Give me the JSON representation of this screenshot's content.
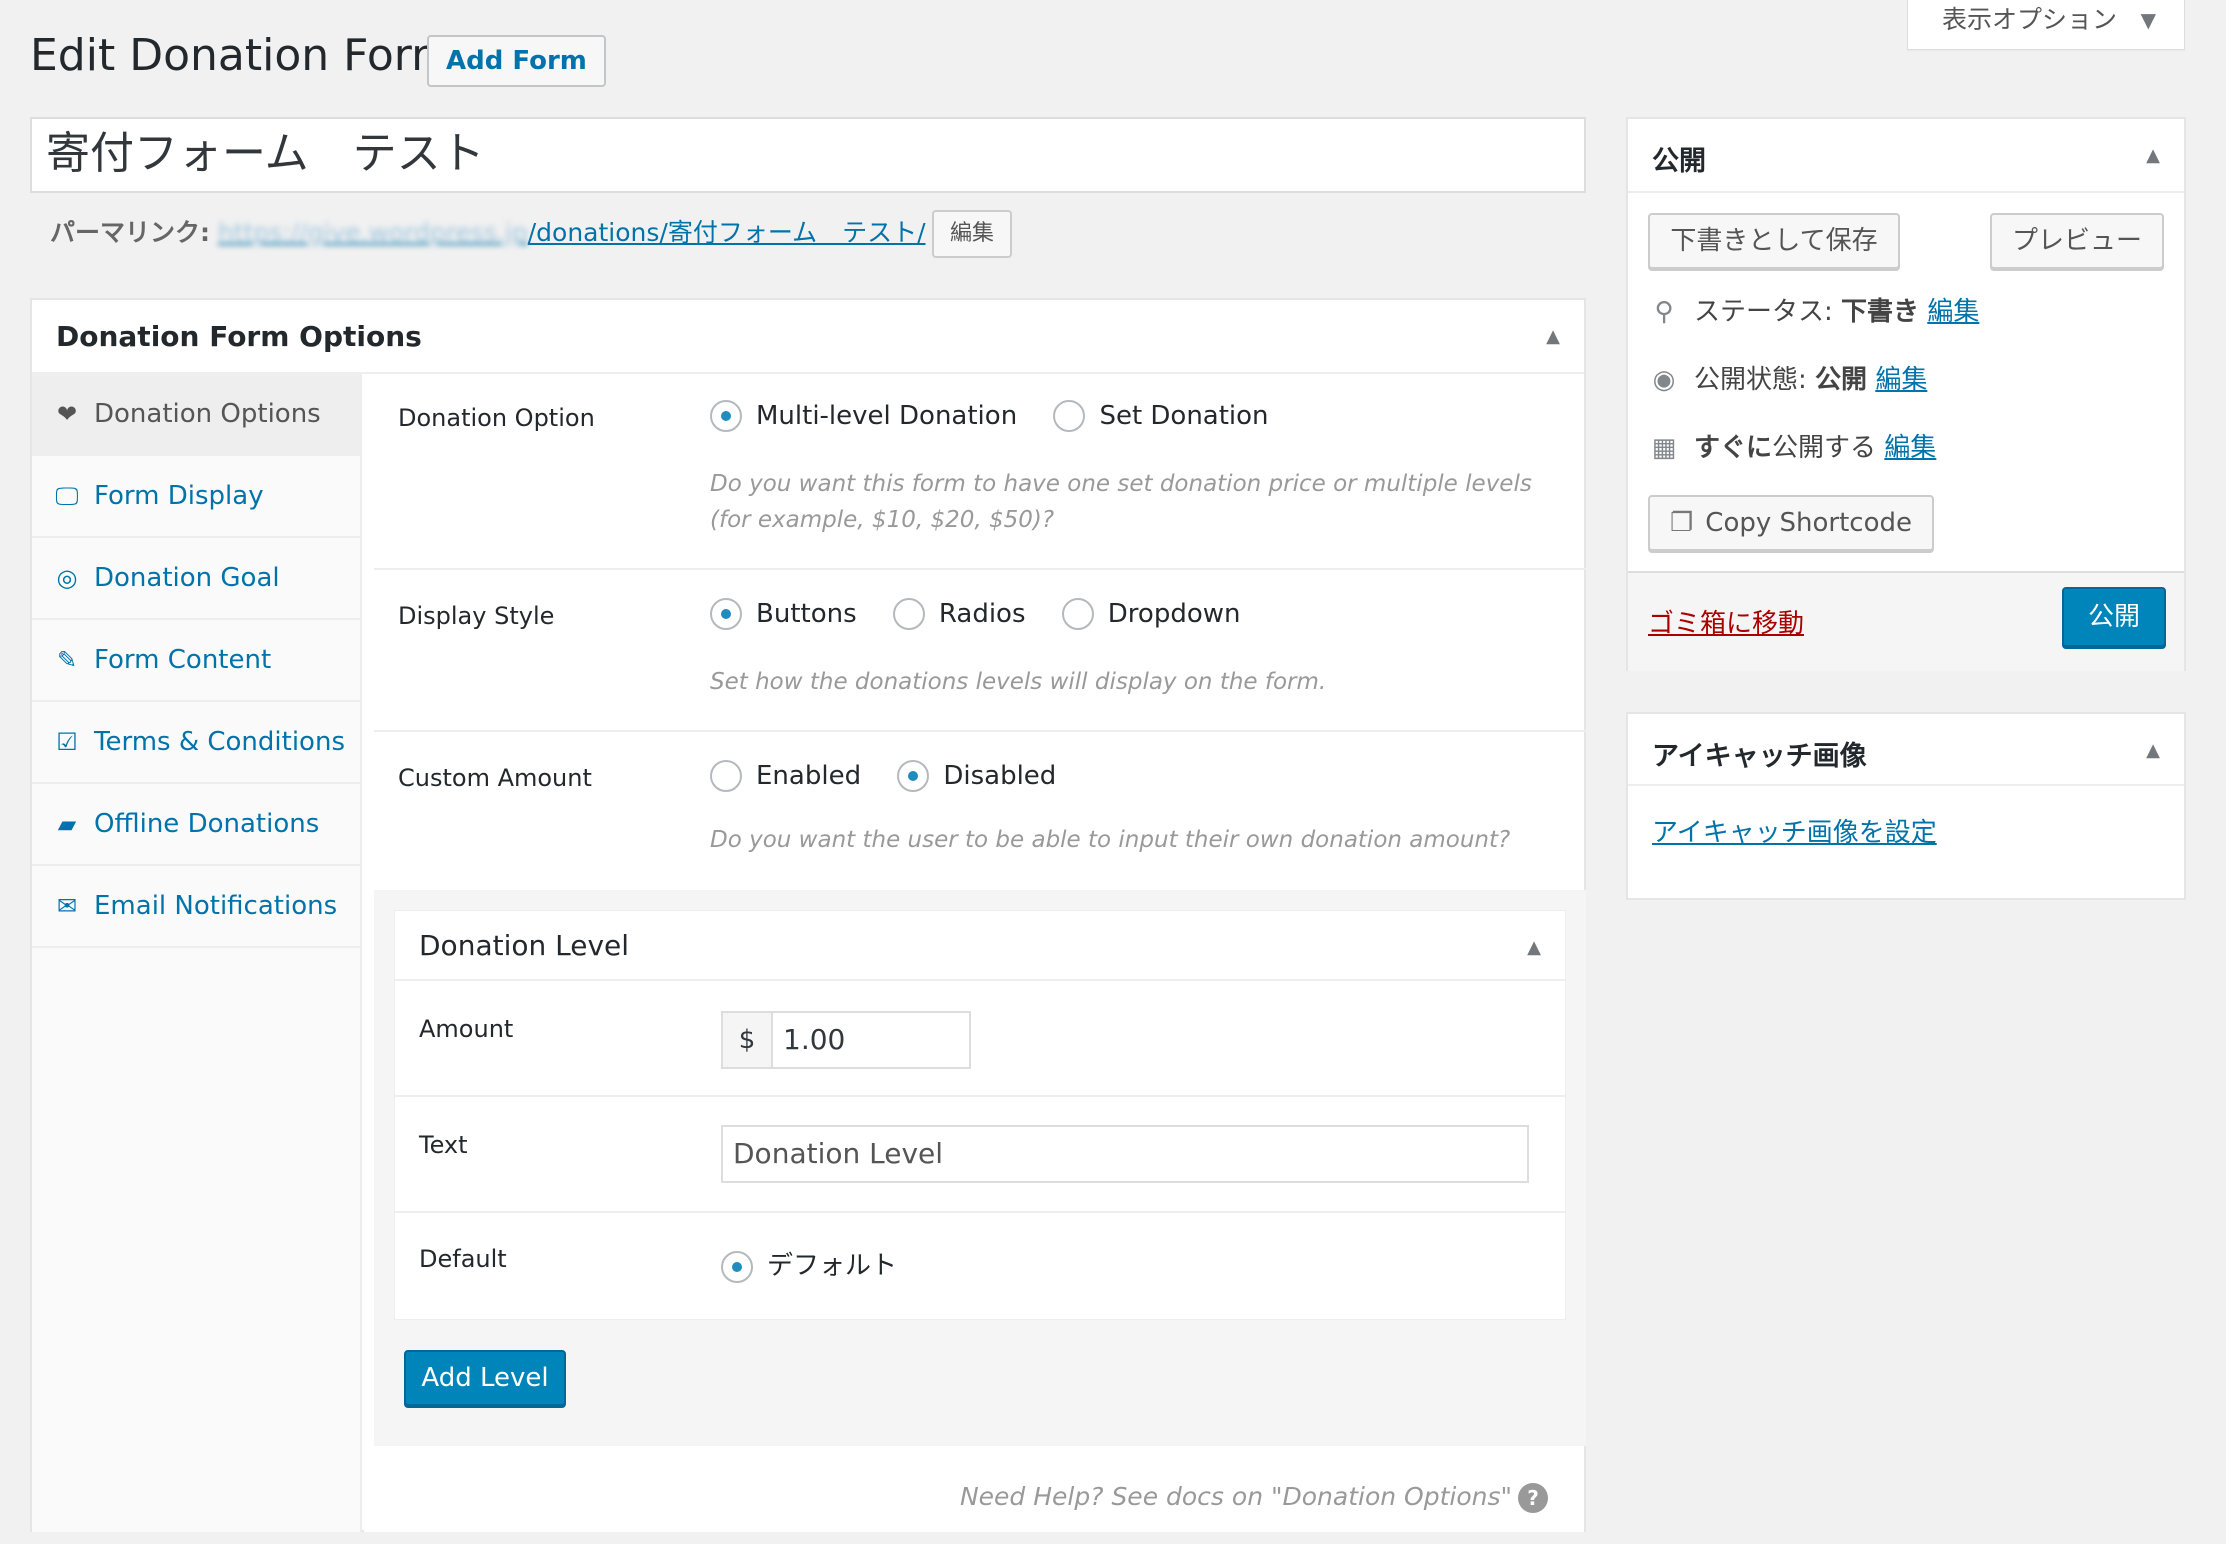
{
  "header": {
    "title": "Edit Donation Form",
    "add_form_label": "Add Form",
    "screen_options_label": "表示オプション"
  },
  "post": {
    "title_value": "寄付フォーム　テスト",
    "permalink_label": "パーマリンク:",
    "permalink_base": "https://give.wordpress.jp",
    "permalink_path": "/donations/寄付フォーム　テスト/",
    "permalink_edit_label": "編集"
  },
  "options_box": {
    "title": "Donation Form Options",
    "tabs": [
      {
        "label": "Donation Options",
        "icon": "heart-icon",
        "glyph": "❤"
      },
      {
        "label": "Form Display",
        "icon": "monitor-icon",
        "glyph": "🖵"
      },
      {
        "label": "Donation Goal",
        "icon": "target-icon",
        "glyph": "◎"
      },
      {
        "label": "Form Content",
        "icon": "edit-icon",
        "glyph": "✎"
      },
      {
        "label": "Terms & Conditions",
        "icon": "checkbox-icon",
        "glyph": "☑"
      },
      {
        "label": "Offline Donations",
        "icon": "wallet-icon",
        "glyph": "▰"
      },
      {
        "label": "Email Notifications",
        "icon": "envelope-icon",
        "glyph": "✉"
      }
    ],
    "donation_option": {
      "label": "Donation Option",
      "options": [
        "Multi-level Donation",
        "Set Donation"
      ],
      "selected": "Multi-level Donation",
      "description": "Do you want this form to have one set donation price or multiple levels (for example, $10, $20, $50)?"
    },
    "display_style": {
      "label": "Display Style",
      "options": [
        "Buttons",
        "Radios",
        "Dropdown"
      ],
      "selected": "Buttons",
      "description": "Set how the donations levels will display on the form."
    },
    "custom_amount": {
      "label": "Custom Amount",
      "options": [
        "Enabled",
        "Disabled"
      ],
      "selected": "Disabled",
      "description": "Do you want the user to be able to input their own donation amount?"
    },
    "donation_level": {
      "title": "Donation Level",
      "amount_label": "Amount",
      "currency_symbol": "$",
      "amount_value": "1.00",
      "text_label": "Text",
      "text_placeholder": "Donation Level",
      "default_label": "Default",
      "default_option": "デフォルト"
    },
    "add_level_label": "Add Level",
    "help_text": "Need Help? See docs on \"Donation Options\"",
    "help_icon": "?"
  },
  "publish_box": {
    "title": "公開",
    "save_draft_label": "下書きとして保存",
    "preview_label": "プレビュー",
    "status_label": "ステータス:",
    "status_value": "下書き",
    "visibility_label": "公開状態:",
    "visibility_value": "公開",
    "schedule_bold": "すぐに",
    "schedule_rest": "公開する",
    "edit_link_label": "編集",
    "copy_shortcode_label": "Copy Shortcode",
    "trash_label": "ゴミ箱に移動",
    "publish_label": "公開"
  },
  "featured_box": {
    "title": "アイキャッチ画像",
    "set_link_label": "アイキャッチ画像を設定"
  },
  "colors": {
    "accent": "#0073aa",
    "primary_button": "#0085ba",
    "trash": "#aa0000",
    "background": "#f1f1f1"
  }
}
